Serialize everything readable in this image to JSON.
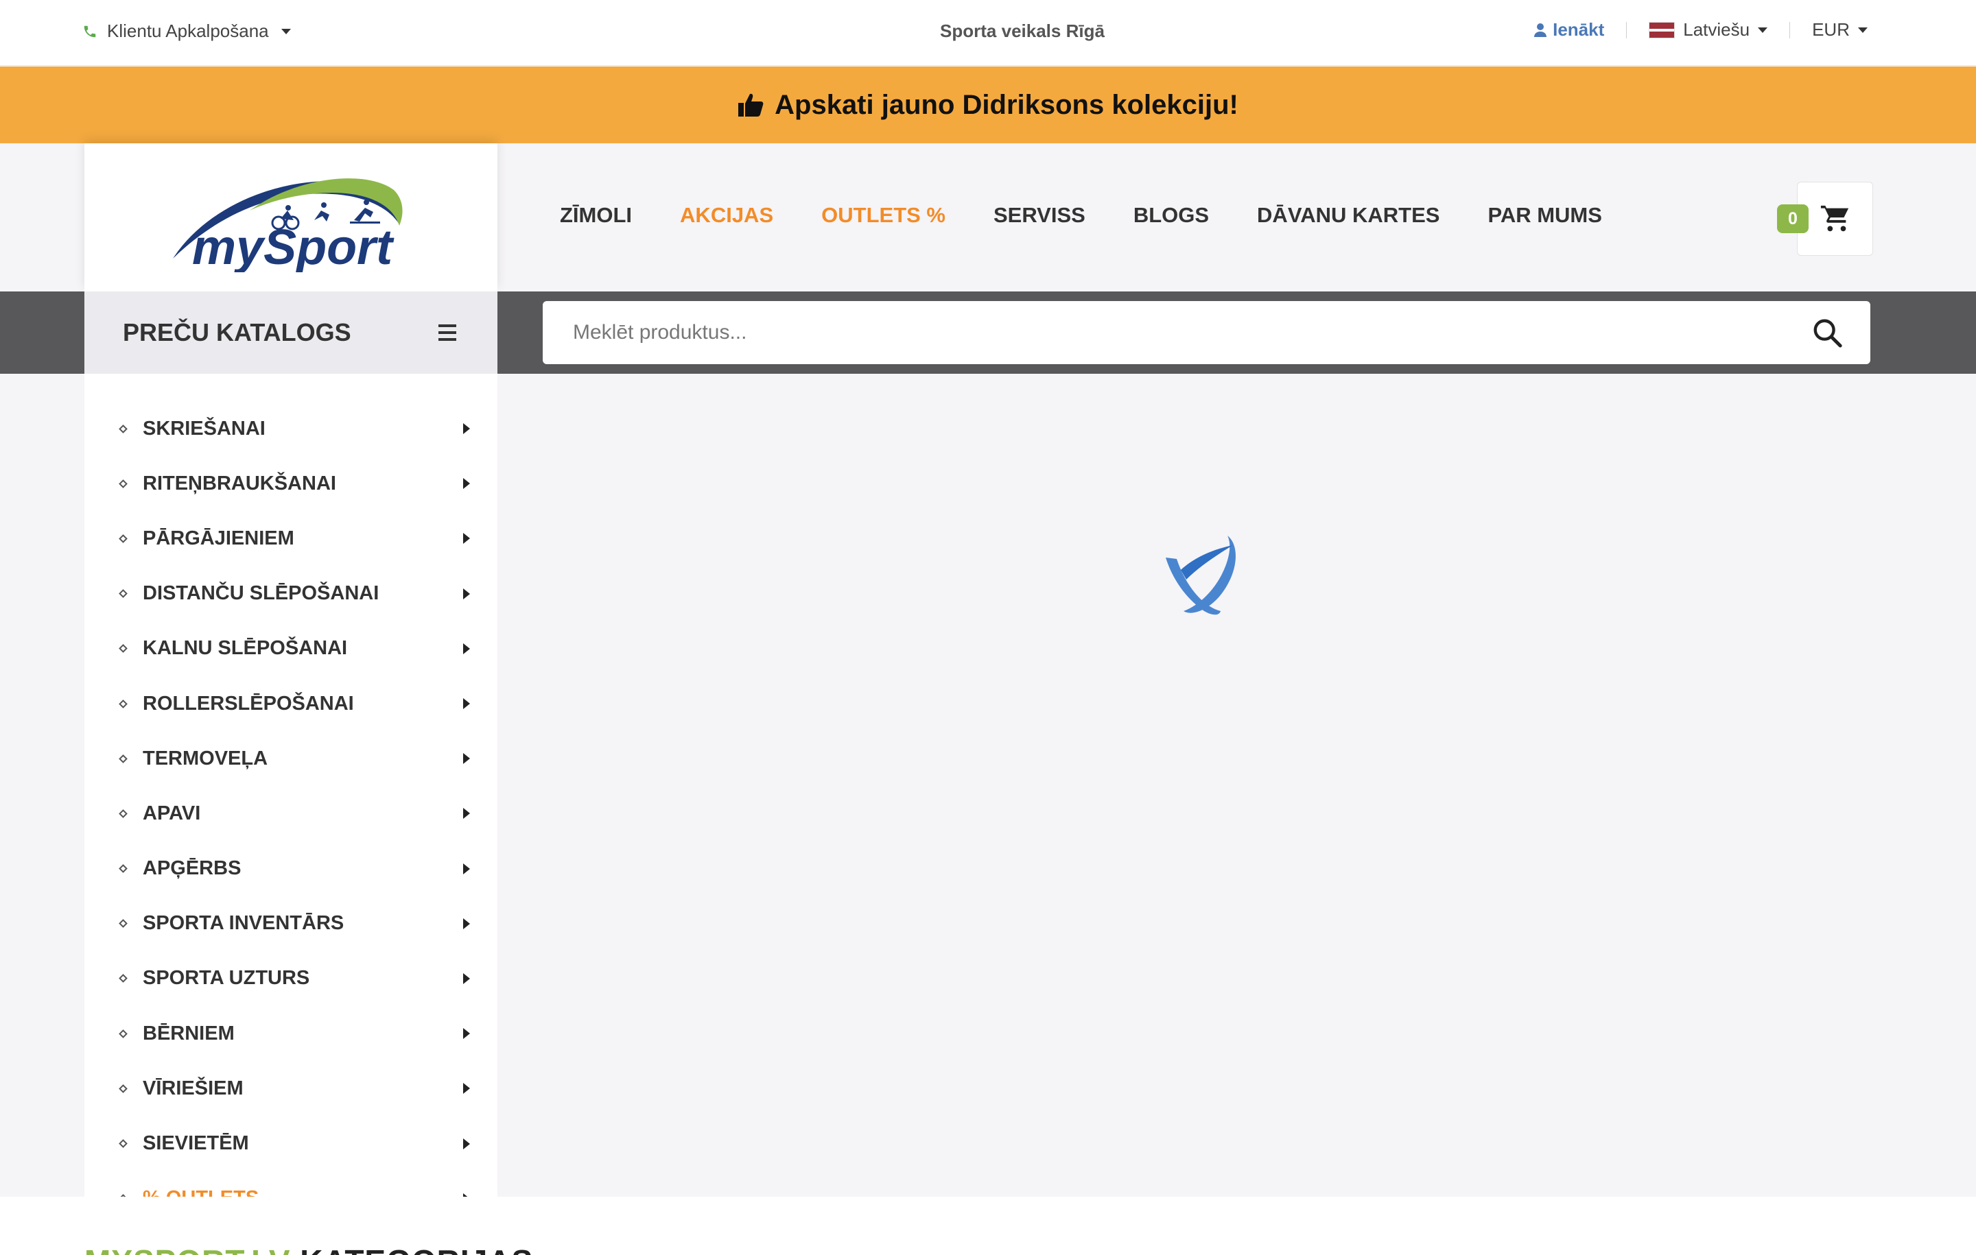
{
  "topbar": {
    "support_label": "Klientu Apkalpošana",
    "store_title": "Sporta veikals Rīgā",
    "login_label": "Ienākt",
    "language": "Latviešu",
    "currency": "EUR"
  },
  "promo": {
    "text": "Apskati jauno Didriksons kolekciju!"
  },
  "brand": {
    "logo_text": "mySport"
  },
  "nav": {
    "items": [
      {
        "label": "ZĪMOLI"
      },
      {
        "label": "AKCIJAS"
      },
      {
        "label": "OUTLETS %"
      },
      {
        "label": "SERVISS"
      },
      {
        "label": "BLOGS"
      },
      {
        "label": "DĀVANU KARTES"
      },
      {
        "label": "PAR MUMS"
      }
    ]
  },
  "cart": {
    "count": "0"
  },
  "catalog": {
    "title": "PREČU KATALOGS",
    "items": [
      {
        "label": "SKRIEŠANAI"
      },
      {
        "label": "RITEŅBRAUKŠANAI"
      },
      {
        "label": "PĀRGĀJIENIEM"
      },
      {
        "label": "DISTANČU SLĒPOŠANAI"
      },
      {
        "label": "KALNU SLĒPOŠANAI"
      },
      {
        "label": "ROLLERSLĒPOŠANAI"
      },
      {
        "label": "TERMOVEĻA"
      },
      {
        "label": "APAVI"
      },
      {
        "label": "APĢĒRBS"
      },
      {
        "label": "SPORTA INVENTĀRS"
      },
      {
        "label": "SPORTA UZTURS"
      },
      {
        "label": "BĒRNIEM"
      },
      {
        "label": "VĪRIEŠIEM"
      },
      {
        "label": "SIEVIETĒM"
      },
      {
        "label": "% OUTLETS"
      }
    ]
  },
  "search": {
    "placeholder": "Meklēt produktus..."
  },
  "section": {
    "title_green": "MYSPORT.LV",
    "title_rest": " KATEGORIJAS"
  },
  "colors": {
    "promo_bg": "#f4a93f",
    "accent_orange": "#f28c28",
    "brand_green": "#8db849",
    "brand_blue": "#1d3a7a",
    "dark_strip": "#58585a",
    "link_blue": "#4a78b6"
  }
}
